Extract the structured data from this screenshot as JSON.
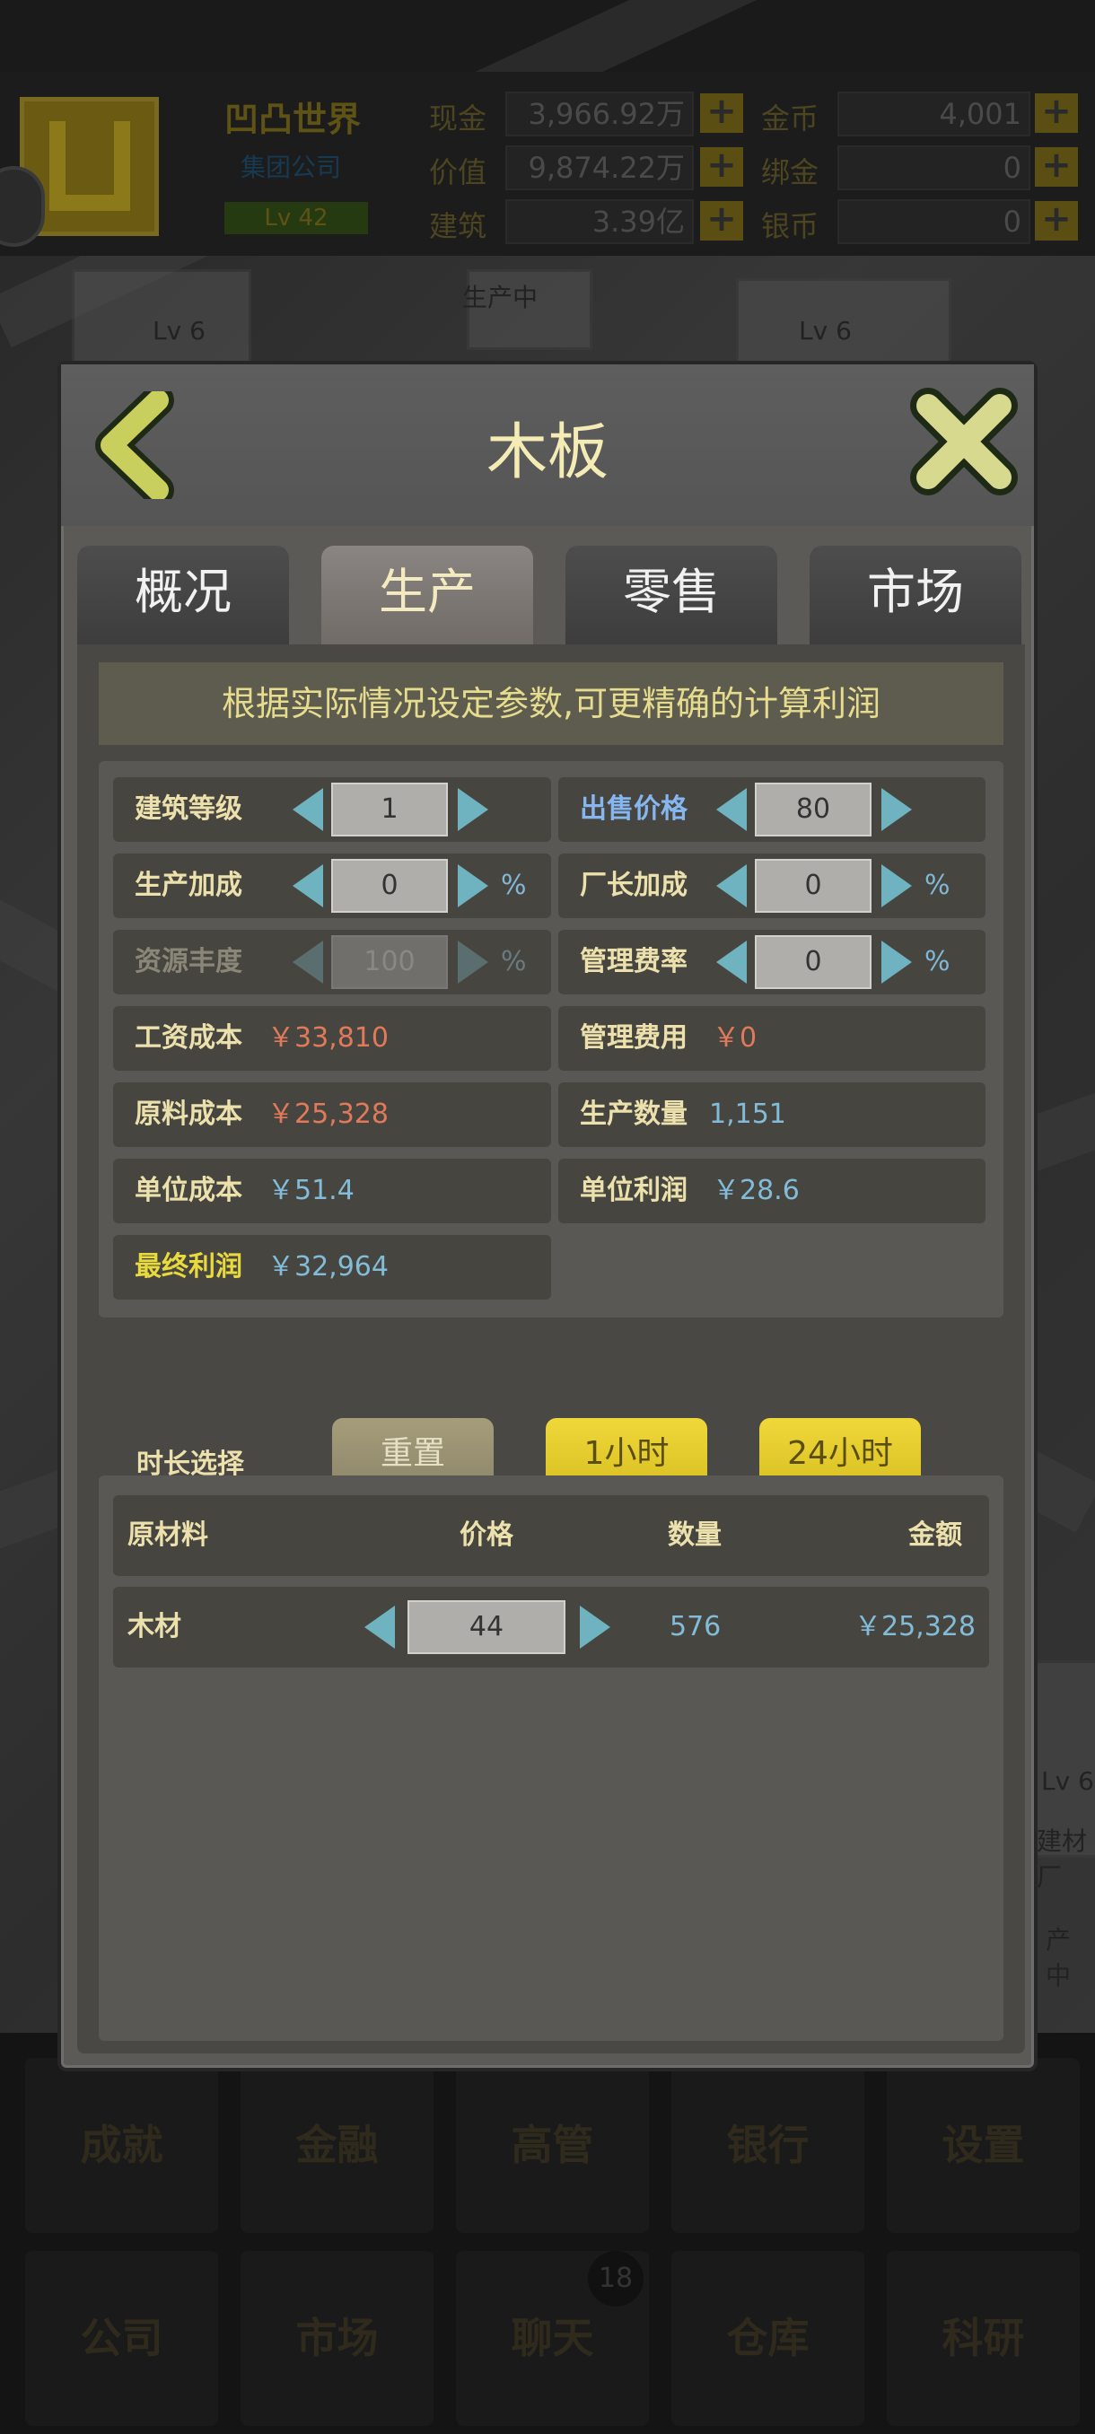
{
  "topbar": {
    "company_name": "凹凸世界",
    "company_type": "集团公司",
    "level": "Lv 42",
    "stats": [
      {
        "label": "现金",
        "value": "3,966.92万"
      },
      {
        "label": "价值",
        "value": "9,874.22万"
      },
      {
        "label": "建筑",
        "value": "3.39亿"
      },
      {
        "label": "金币",
        "value": "4,001"
      },
      {
        "label": "绑金",
        "value": "0"
      },
      {
        "label": "银币",
        "value": "0"
      }
    ],
    "plus": "+"
  },
  "background": {
    "lv_a": "Lv 6",
    "lv_b": "Lv 6",
    "status": "生产中",
    "side_lv": "Lv 6",
    "side_fac": "建材厂",
    "side_prod": "产中"
  },
  "dialog": {
    "title": "木板",
    "tabs": [
      "概况",
      "生产",
      "零售",
      "市场"
    ],
    "active_tab": 1,
    "notice": "根据实际情况设定参数,可更精确的计算利润",
    "params": {
      "building_level": {
        "label": "建筑等级",
        "value": "1"
      },
      "sell_price": {
        "label": "出售价格",
        "value": "80"
      },
      "production_bonus": {
        "label": "生产加成",
        "value": "0",
        "unit": "%"
      },
      "manager_bonus": {
        "label": "厂长加成",
        "value": "0",
        "unit": "%"
      },
      "resource_abundance": {
        "label": "资源丰度",
        "value": "100",
        "unit": "%"
      },
      "management_rate": {
        "label": "管理费率",
        "value": "0",
        "unit": "%"
      },
      "wage_cost": {
        "label": "工资成本",
        "value": "￥33,810"
      },
      "management_fee": {
        "label": "管理费用",
        "value": "￥0"
      },
      "material_cost": {
        "label": "原料成本",
        "value": "￥25,328"
      },
      "production_qty": {
        "label": "生产数量",
        "value": "1,151"
      },
      "unit_cost": {
        "label": "单位成本",
        "value": "￥51.4"
      },
      "unit_profit": {
        "label": "单位利润",
        "value": "￥28.6"
      },
      "final_profit": {
        "label": "最终利润",
        "value": "￥32,964"
      }
    },
    "duration": {
      "label": "时长选择",
      "reset": "重置",
      "one_hour": "1小时",
      "day": "24小时"
    },
    "materials": {
      "headers": [
        "原材料",
        "价格",
        "数量",
        "金额"
      ],
      "rows": [
        {
          "name": "木材",
          "price": "44",
          "qty": "576",
          "amount": "￥25,328"
        }
      ]
    }
  },
  "bottom_nav": {
    "row1": [
      "成就",
      "金融",
      "高管",
      "银行",
      "设置"
    ],
    "row2": [
      "公司",
      "市场",
      "聊天",
      "仓库",
      "科研"
    ],
    "chat_badge": "18"
  },
  "colors": {
    "accent_yellow": "#e8d93e",
    "panel": "#5b5a57",
    "cyan_value": "#82bcd8",
    "red_value": "#e07a5a"
  }
}
